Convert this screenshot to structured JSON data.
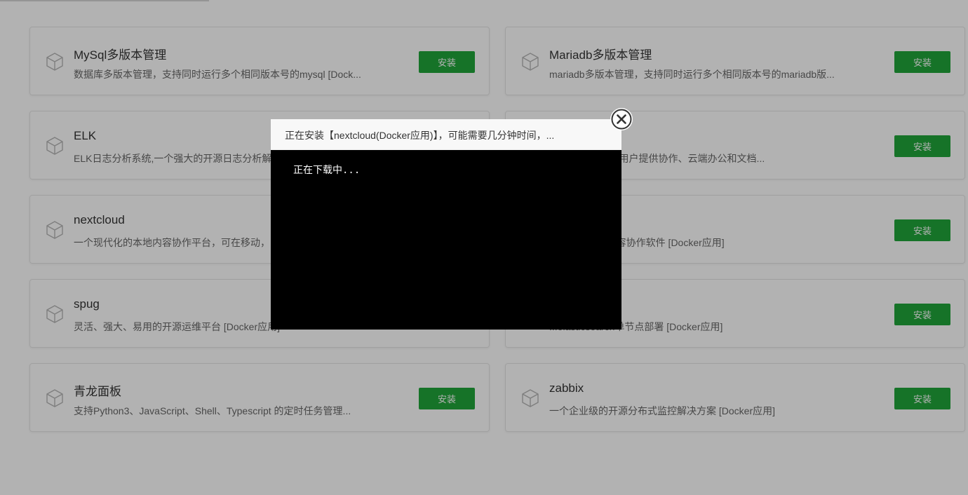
{
  "apps": [
    {
      "name": "MySql多版本管理",
      "desc": "数据库多版本管理，支持同时运行多个相同版本号的mysql [Dock...",
      "button": "安装"
    },
    {
      "name": "Mariadb多版本管理",
      "desc": "mariadb多版本管理，支持同时运行多个相同版本号的mariadb版...",
      "button": "安装"
    },
    {
      "name": "ELK",
      "desc": "ELK日志分析系统,一个强大的开源日志分析解...",
      "button": "安装"
    },
    {
      "name": "",
      "desc": "...源办公套件,为用户提供协作、云端办公和文档...",
      "button": "安装"
    },
    {
      "name": "nextcloud",
      "desc": "一个现代化的本地内容协作平台，可在移动，",
      "button": "安装"
    },
    {
      "name": "",
      "desc": "...步、共享和内容协作软件 [Docker应用]",
      "button": "安装"
    },
    {
      "name": "spug",
      "desc": "灵活、强大、易用的开源运维平台 [Docker应用]",
      "button": "安装"
    },
    {
      "name": "",
      "desc": "...elasticsearch单节点部署 [Docker应用]",
      "button": "安装"
    },
    {
      "name": "青龙面板",
      "desc": "支持Python3、JavaScript、Shell、Typescript 的定时任务管理...",
      "button": "安装"
    },
    {
      "name": "zabbix",
      "desc": "一个企业级的开源分布式监控解决方案 [Docker应用]",
      "button": "安装"
    }
  ],
  "dialog": {
    "title": "正在安装【nextcloud(Docker应用)】，可能需要几分钟时间，...",
    "log": "正在下载中..."
  },
  "colors": {
    "install_button": "#20a53a",
    "overlay": "rgba(0,0,0,0.3)",
    "terminal_bg": "#000000"
  },
  "icons": {
    "app": "cube-icon",
    "close": "close-icon"
  }
}
